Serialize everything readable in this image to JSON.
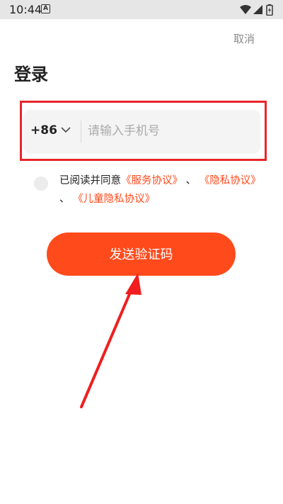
{
  "status_bar": {
    "time": "10:44",
    "notification_icon": "a-icon",
    "right_icons": [
      "wifi-icon",
      "signal-icon",
      "battery-icon"
    ]
  },
  "header": {
    "cancel_label": "取消",
    "title": "登录"
  },
  "phone_form": {
    "country_code": "+86",
    "placeholder": "请输入手机号",
    "value": ""
  },
  "agreement": {
    "prefix": "已阅读并同意",
    "service_link": "《服务协议》",
    "sep1": "、",
    "privacy_link": "《隐私协议》",
    "sep2": "、",
    "child_privacy_link": "《儿童隐私协议》",
    "checked": false
  },
  "send_button": {
    "label": "发送验证码"
  },
  "colors": {
    "accent": "#ff4a1c",
    "annotation": "#e8262a"
  }
}
